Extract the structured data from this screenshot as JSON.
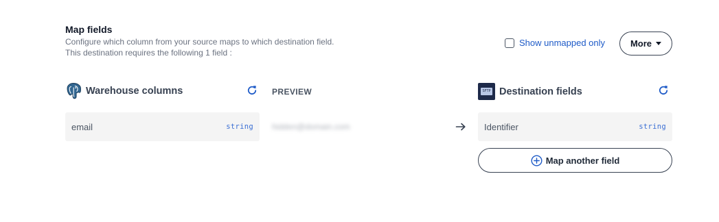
{
  "header": {
    "title": "Map fields",
    "description_line1": "Configure which column from your source maps to which destination field.",
    "description_line2": "This destination requires the following 1 field :"
  },
  "filter": {
    "show_unmapped_label": "Show unmapped only",
    "checked": false
  },
  "more_button": {
    "label": "More"
  },
  "source": {
    "heading": "Warehouse columns",
    "icon": "postgresql-elephant-icon",
    "field": {
      "name": "email",
      "type": "string"
    }
  },
  "preview": {
    "heading": "PREVIEW",
    "value": "hidden@domain.com"
  },
  "destination": {
    "heading": "Destination fields",
    "icon": "sftp-destination-icon",
    "field": {
      "name": "Identifier",
      "type": "string"
    }
  },
  "map_another": {
    "label": "Map another field"
  },
  "colors": {
    "accent_blue": "#1d5ac7",
    "type_blue": "#3b6fd4",
    "field_bg": "#f4f4f4"
  }
}
